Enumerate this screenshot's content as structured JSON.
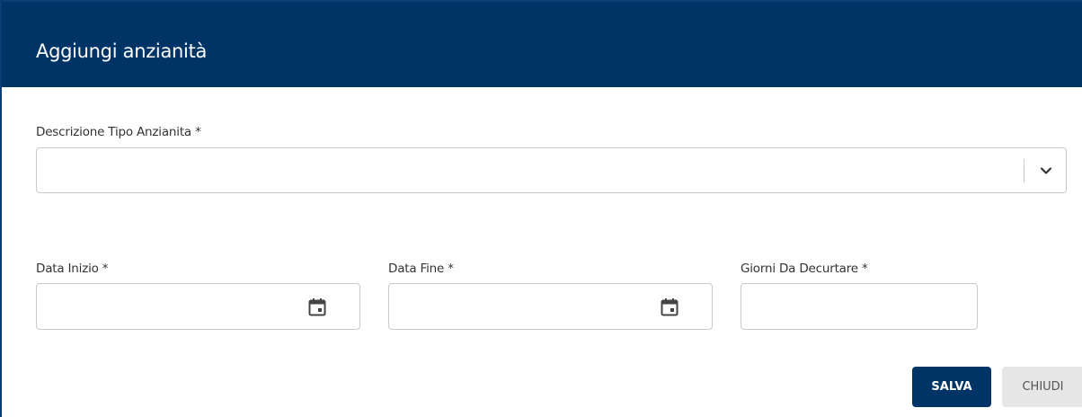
{
  "dialog": {
    "title": "Aggiungi anzianità"
  },
  "form": {
    "tipo_anzianita": {
      "label": "Descrizione Tipo Anzianita *",
      "value": ""
    },
    "data_inizio": {
      "label": "Data Inizio *",
      "value": ""
    },
    "data_fine": {
      "label": "Data Fine *",
      "value": ""
    },
    "giorni_da_decurtare": {
      "label": "Giorni Da Decurtare *",
      "value": ""
    }
  },
  "actions": {
    "save_label": "SALVA",
    "close_label": "CHIUDI"
  },
  "colors": {
    "primary": "#003466",
    "secondary_button": "#e6e6e6"
  },
  "icons": {
    "select_arrow": "chevron-down-icon",
    "date_picker": "calendar-icon"
  }
}
